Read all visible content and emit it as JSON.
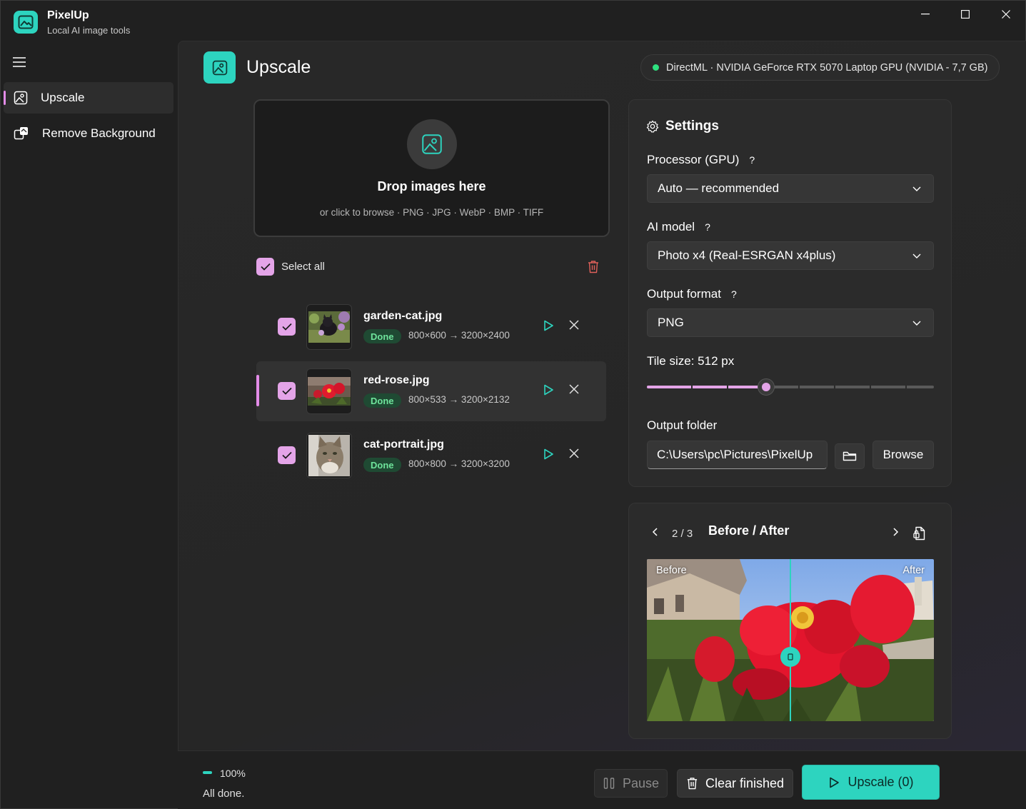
{
  "app": {
    "name": "PixelUp",
    "subtitle": "Local AI image tools"
  },
  "sidebar": {
    "items": [
      {
        "label": "Upscale",
        "icon": "image-icon",
        "active": true
      },
      {
        "label": "Remove Background",
        "icon": "remove-background-icon",
        "active": false
      }
    ]
  },
  "page": {
    "title": "Upscale",
    "gpu_status": "DirectML · NVIDIA GeForce RTX 5070 Laptop GPU (NVIDIA - 7,7 GB)",
    "gpu_status_color": "#2ee07f"
  },
  "dropzone": {
    "title": "Drop images here",
    "subtitle": "or click to browse  ·  PNG · JPG · WebP · BMP · TIFF"
  },
  "queue": {
    "select_all_label": "Select all",
    "items": [
      {
        "name": "garden-cat.jpg",
        "status": "Done",
        "dims": "800×600 → 3200×2400",
        "checked": true
      },
      {
        "name": "red-rose.jpg",
        "status": "Done",
        "dims": "800×533 → 3200×2132",
        "checked": true
      },
      {
        "name": "cat-portrait.jpg",
        "status": "Done",
        "dims": "800×800 → 3200×3200",
        "checked": true
      }
    ]
  },
  "settings": {
    "title": "Settings",
    "processor_label": "Processor (GPU)",
    "processor_value": "Auto — recommended",
    "model_label": "AI model",
    "model_value": "Photo x4 (Real-ESRGAN x4plus)",
    "format_label": "Output format",
    "format_value": "PNG",
    "help_glyph": "?",
    "tile_label": "Tile size: 512 px",
    "tile_fraction": 0.416,
    "output_folder_label": "Output folder",
    "output_folder_value": "C:\\Users\\pc\\Pictures\\PixelUp",
    "browse_label": "Browse"
  },
  "compare": {
    "counter": "2 / 3",
    "title": "Before / After",
    "before_label": "Before",
    "after_label": "After",
    "split_fraction": 0.5
  },
  "footer": {
    "progress": "100%",
    "status": "All done.",
    "pause_label": "Pause",
    "clear_label": "Clear finished",
    "upscale_label": "Upscale (0)"
  },
  "colors": {
    "accent": "#2dd4bf",
    "selection": "#e4a4e8",
    "done_badge": "#6ee39b"
  }
}
